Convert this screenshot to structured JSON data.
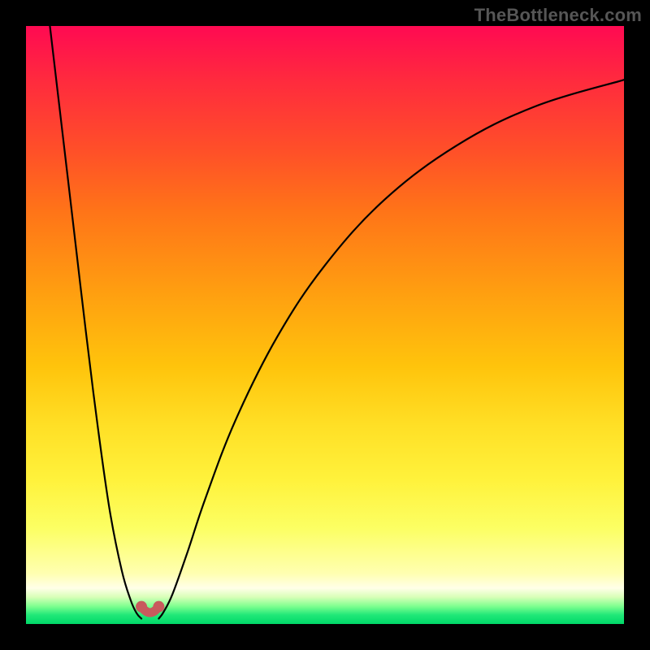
{
  "attribution": "TheBottleneck.com",
  "chart_data": {
    "type": "line",
    "title": "",
    "xlabel": "",
    "ylabel": "",
    "xlim": [
      0,
      100
    ],
    "ylim": [
      0,
      100
    ],
    "series": [
      {
        "name": "left-branch",
        "x": [
          4,
          6,
          8,
          10,
          12,
          14,
          16,
          17.5,
          18.5,
          19.3
        ],
        "y": [
          100,
          83,
          66,
          49,
          33,
          19,
          9,
          4,
          1.8,
          0.9
        ]
      },
      {
        "name": "right-branch",
        "x": [
          22.2,
          23,
          24.5,
          27,
          30,
          35,
          42,
          50,
          60,
          72,
          85,
          100
        ],
        "y": [
          0.9,
          2.0,
          5,
          12,
          21,
          34,
          48,
          60,
          71,
          80,
          86.5,
          91
        ]
      }
    ],
    "trough": {
      "points": [
        {
          "x": 19.3,
          "y": 2.9
        },
        {
          "x": 22.2,
          "y": 2.9
        }
      ],
      "bridge_y": 0.9
    }
  }
}
